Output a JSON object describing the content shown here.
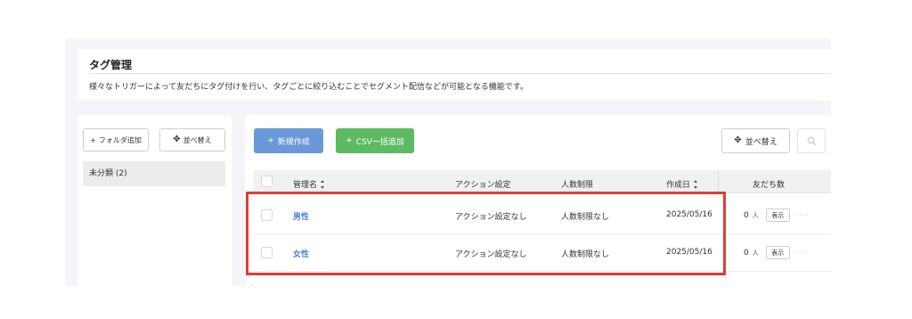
{
  "header": {
    "title": "タグ管理",
    "description": "様々なトリガーによって友だちにタグ付けを行い、タグごとに絞り込むことでセグメント配信などが可能となる機能です。"
  },
  "sidebar": {
    "add_folder_icon": "+",
    "add_folder_label": "フォルダ追加",
    "sort_icon": "✥",
    "sort_label": "並べ替え",
    "folders": [
      {
        "label": "未分類 (2)"
      }
    ]
  },
  "toolbar": {
    "new_icon": "+",
    "new_label": "新規作成",
    "csv_icon": "+",
    "csv_label": "CSV一括追加",
    "sort_icon": "✥",
    "sort_label": "並べ替え",
    "search_icon": "search-icon"
  },
  "table": {
    "columns": {
      "name": "管理名",
      "action": "アクション設定",
      "limit": "人数制限",
      "created": "作成日",
      "friends": "友だち数"
    },
    "rows": [
      {
        "name": "男性",
        "action": "アクション設定なし",
        "limit": "人数制限なし",
        "created": "2025/05/16",
        "friends": "0",
        "unit": "人",
        "show": "表示",
        "more": "···"
      },
      {
        "name": "女性",
        "action": "アクション設定なし",
        "limit": "人数制限なし",
        "created": "2025/05/16",
        "friends": "0",
        "unit": "人",
        "show": "表示",
        "more": "···"
      }
    ]
  },
  "colors": {
    "primary_blue": "#6a99d7",
    "success_green": "#5cba63",
    "link_blue": "#4a86d1",
    "highlight_red": "#e43b38"
  }
}
